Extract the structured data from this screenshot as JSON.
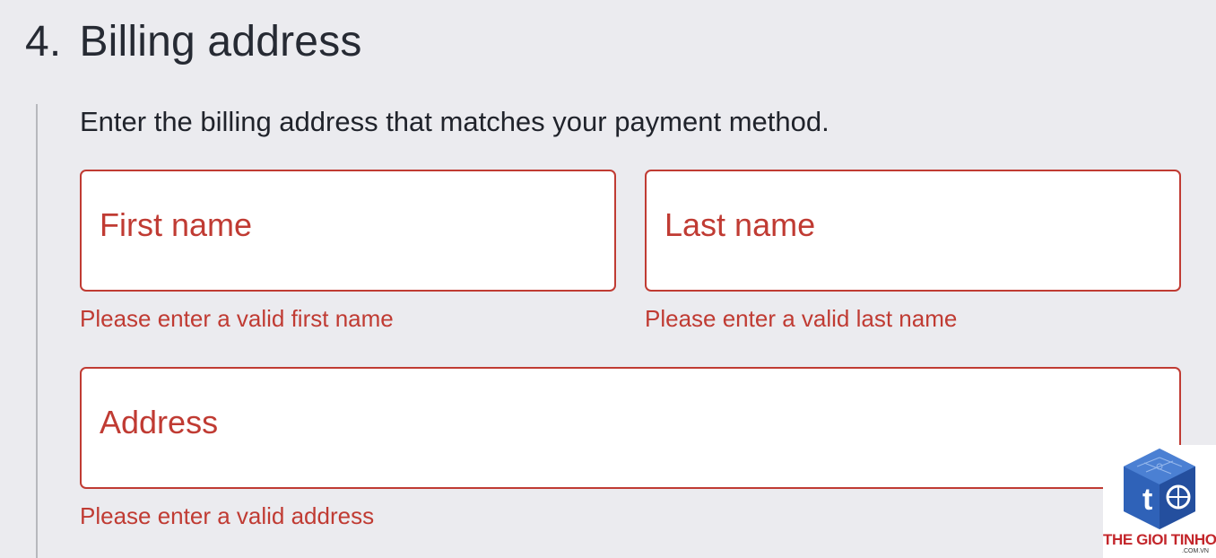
{
  "section": {
    "number": "4.",
    "title": "Billing address",
    "intro": "Enter the billing address that matches your payment method."
  },
  "fields": {
    "first_name": {
      "label": "First name",
      "value": "",
      "error": "Please enter a valid first name"
    },
    "last_name": {
      "label": "Last name",
      "value": "",
      "error": "Please enter a valid last name"
    },
    "address": {
      "label": "Address",
      "value": "",
      "error": "Please enter a valid address"
    }
  },
  "watermark": {
    "name": "THE GIOI TINHOC",
    "domain": ".COM.VN",
    "icon": "cube-logo-icon"
  },
  "colors": {
    "error": "#c03b33",
    "background": "#ebebef",
    "text": "#20232b",
    "rail": "#b7b8bd",
    "logo_blue": "#2f62b8",
    "logo_red": "#c3262b"
  }
}
